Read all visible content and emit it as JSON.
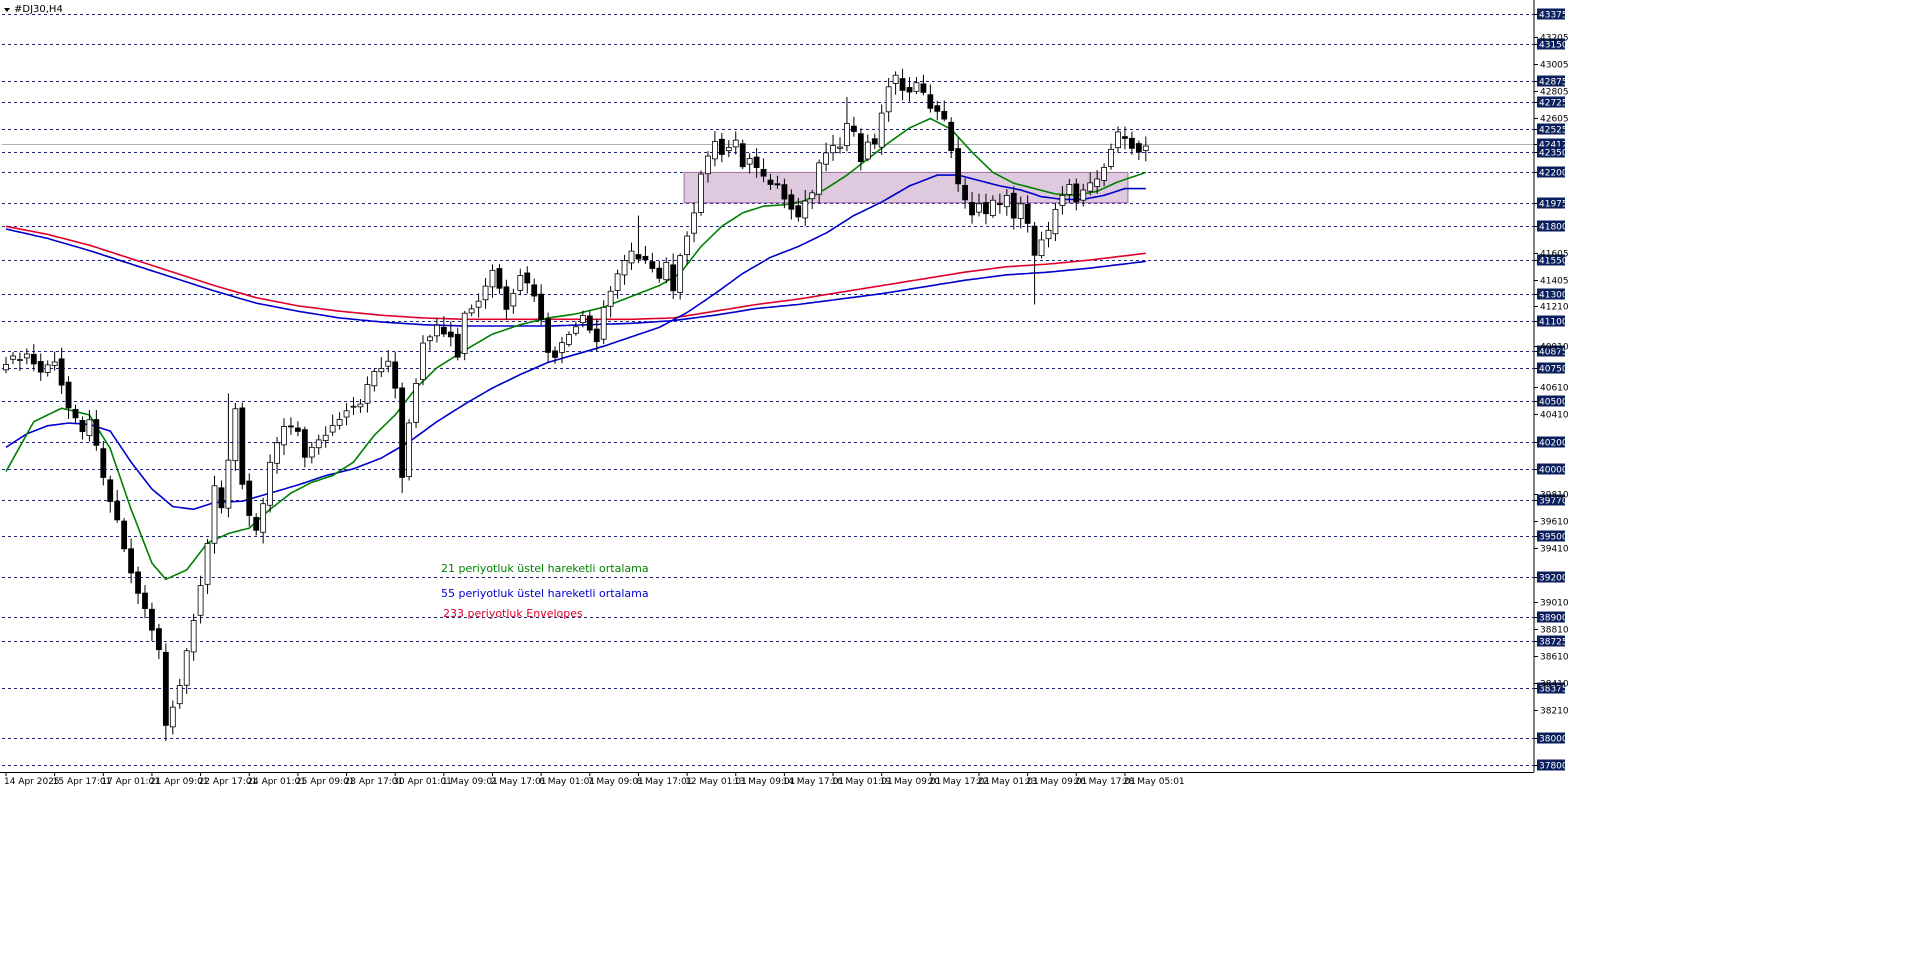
{
  "window": {
    "title": "#DJ30,H4"
  },
  "colors": {
    "background": "#ffffff",
    "grid": "#1a237e",
    "candle_up_fill": "#ffffff",
    "candle_down_fill": "#000000",
    "candle_outline": "#000000",
    "ema21": "#008000",
    "ema55": "#0000cd",
    "envelope_upper": "#e0002a",
    "envelope_lower": "#0000cd",
    "zone_fill": "#d8bfd8",
    "zone_stroke": "#a070a0",
    "label_box": "#0b1f5c",
    "label_text": "#ffffff",
    "price_line": "#b0b0b0"
  },
  "legend": [
    {
      "id": "ema21",
      "label": "21 periyotluk üstel hareketli ortalama",
      "color": "#008000"
    },
    {
      "id": "ema55",
      "label": "55 periyotluk üstel hareketli ortalama",
      "color": "#0000cd"
    },
    {
      "id": "env233",
      "label": "233 periyotluk Envelopes",
      "color": "#e0002a"
    }
  ],
  "chart_data": {
    "type": "candlestick",
    "symbol": "#DJ30",
    "timeframe": "H4",
    "ylim": [
      37750,
      43450
    ],
    "xlim": [
      0,
      207
    ],
    "grid": true,
    "current_price": 42412,
    "y_ticks_labeled": [
      43375,
      43150,
      42875,
      42725,
      42525,
      42412,
      42350,
      42200,
      41975,
      41800,
      41550,
      41300,
      41100,
      40875,
      40750,
      40500,
      40200,
      40000,
      39770,
      39500,
      39200,
      38900,
      38725,
      38375,
      38000,
      37800
    ],
    "y_ticks_minor": [
      43205,
      43005,
      42805,
      42605,
      41605,
      41405,
      41210,
      40910,
      40610,
      40410,
      39810,
      39610,
      39410,
      39010,
      38810,
      38610,
      38410,
      38210
    ],
    "x_ticks": [
      {
        "index": 0,
        "label": "14 Apr 2025"
      },
      {
        "index": 7,
        "label": "15 Apr 17:01"
      },
      {
        "index": 14,
        "label": "17 Apr 01:01"
      },
      {
        "index": 21,
        "label": "21 Apr 09:01"
      },
      {
        "index": 28,
        "label": "22 Apr 17:01"
      },
      {
        "index": 35,
        "label": "24 Apr 01:01"
      },
      {
        "index": 42,
        "label": "25 Apr 09:01"
      },
      {
        "index": 49,
        "label": "28 Apr 17:01"
      },
      {
        "index": 56,
        "label": "30 Apr 01:01"
      },
      {
        "index": 63,
        "label": "1 May 09:01"
      },
      {
        "index": 70,
        "label": "2 May 17:01"
      },
      {
        "index": 77,
        "label": "6 May 01:01"
      },
      {
        "index": 84,
        "label": "7 May 09:01"
      },
      {
        "index": 91,
        "label": "8 May 17:01"
      },
      {
        "index": 98,
        "label": "12 May 01:01"
      },
      {
        "index": 105,
        "label": "13 May 09:01"
      },
      {
        "index": 112,
        "label": "14 May 17:01"
      },
      {
        "index": 119,
        "label": "16 May 01:01"
      },
      {
        "index": 126,
        "label": "19 May 09:01"
      },
      {
        "index": 133,
        "label": "20 May 17:01"
      },
      {
        "index": 140,
        "label": "22 May 01:01"
      },
      {
        "index": 147,
        "label": "23 May 09:01"
      },
      {
        "index": 154,
        "label": "26 May 17:01"
      },
      {
        "index": 161,
        "label": "28 May 05:01"
      }
    ],
    "zone": {
      "x_start": 98,
      "x_end": 161,
      "y_low": 41975,
      "y_high": 42200
    },
    "close_anchors": [
      [
        0,
        40800
      ],
      [
        3,
        40850
      ],
      [
        5,
        40720
      ],
      [
        7,
        40810
      ],
      [
        9,
        40450
      ],
      [
        11,
        40260
      ],
      [
        12,
        40380
      ],
      [
        14,
        39920
      ],
      [
        16,
        39600
      ],
      [
        18,
        39220
      ],
      [
        20,
        38950
      ],
      [
        22,
        38650
      ],
      [
        23,
        38100
      ],
      [
        25,
        38400
      ],
      [
        27,
        38900
      ],
      [
        28,
        39150
      ],
      [
        29,
        39450
      ],
      [
        30,
        39850
      ],
      [
        31,
        39700
      ],
      [
        33,
        40450
      ],
      [
        34,
        39900
      ],
      [
        35,
        39650
      ],
      [
        36,
        39520
      ],
      [
        37,
        39720
      ],
      [
        38,
        40050
      ],
      [
        40,
        40310
      ],
      [
        42,
        40280
      ],
      [
        43,
        40100
      ],
      [
        45,
        40200
      ],
      [
        47,
        40320
      ],
      [
        49,
        40450
      ],
      [
        51,
        40500
      ],
      [
        53,
        40720
      ],
      [
        55,
        40780
      ],
      [
        56,
        40600
      ],
      [
        57,
        39950
      ],
      [
        58,
        40350
      ],
      [
        60,
        40950
      ],
      [
        62,
        41050
      ],
      [
        64,
        41000
      ],
      [
        65,
        40850
      ],
      [
        66,
        41150
      ],
      [
        68,
        41250
      ],
      [
        70,
        41480
      ],
      [
        72,
        41200
      ],
      [
        74,
        41450
      ],
      [
        76,
        41300
      ],
      [
        77,
        41100
      ],
      [
        78,
        40880
      ],
      [
        79,
        40850
      ],
      [
        81,
        41000
      ],
      [
        83,
        41150
      ],
      [
        85,
        40950
      ],
      [
        86,
        41200
      ],
      [
        88,
        41450
      ],
      [
        90,
        41600
      ],
      [
        92,
        41550
      ],
      [
        94,
        41400
      ],
      [
        95,
        41520
      ],
      [
        96,
        41300
      ],
      [
        97,
        41600
      ],
      [
        98,
        41750
      ],
      [
        99,
        41900
      ],
      [
        100,
        42200
      ],
      [
        101,
        42300
      ],
      [
        102,
        42450
      ],
      [
        103,
        42350
      ],
      [
        105,
        42420
      ],
      [
        106,
        42250
      ],
      [
        107,
        42300
      ],
      [
        109,
        42150
      ],
      [
        111,
        42100
      ],
      [
        113,
        41950
      ],
      [
        114,
        41870
      ],
      [
        115,
        41990
      ],
      [
        116,
        42050
      ],
      [
        117,
        42250
      ],
      [
        118,
        42350
      ],
      [
        120,
        42400
      ],
      [
        121,
        42550
      ],
      [
        122,
        42480
      ],
      [
        123,
        42300
      ],
      [
        124,
        42450
      ],
      [
        125,
        42400
      ],
      [
        126,
        42650
      ],
      [
        127,
        42850
      ],
      [
        128,
        42900
      ],
      [
        129,
        42820
      ],
      [
        130,
        42800
      ],
      [
        131,
        42850
      ],
      [
        132,
        42780
      ],
      [
        133,
        42700
      ],
      [
        134,
        42650
      ],
      [
        135,
        42580
      ],
      [
        136,
        42380
      ],
      [
        137,
        42100
      ],
      [
        138,
        41980
      ],
      [
        139,
        41900
      ],
      [
        140,
        41970
      ],
      [
        141,
        41880
      ],
      [
        142,
        41980
      ],
      [
        143,
        41950
      ],
      [
        144,
        42050
      ],
      [
        145,
        41850
      ],
      [
        146,
        41950
      ],
      [
        147,
        41800
      ],
      [
        148,
        41580
      ],
      [
        149,
        41700
      ],
      [
        150,
        41750
      ],
      [
        151,
        41950
      ],
      [
        152,
        42050
      ],
      [
        153,
        42100
      ],
      [
        154,
        41980
      ],
      [
        155,
        42050
      ],
      [
        156,
        42100
      ],
      [
        157,
        42150
      ],
      [
        158,
        42250
      ],
      [
        159,
        42380
      ],
      [
        160,
        42480
      ],
      [
        161,
        42450
      ],
      [
        162,
        42400
      ],
      [
        163,
        42350
      ],
      [
        164,
        42412
      ]
    ],
    "wick_extremes": [
      {
        "index": 23,
        "low": 37980
      },
      {
        "index": 29,
        "high": 39480
      },
      {
        "index": 32,
        "high": 40560
      },
      {
        "index": 57,
        "low": 39820
      },
      {
        "index": 91,
        "high": 41880
      },
      {
        "index": 121,
        "high": 42760
      },
      {
        "index": 128,
        "high": 42950
      },
      {
        "index": 148,
        "low": 41220
      },
      {
        "index": 147,
        "high": 42030
      }
    ],
    "series": [
      {
        "name": "21 periyotluk üstel hareketli ortalama",
        "color": "#008000",
        "points": [
          [
            0,
            39980
          ],
          [
            4,
            40350
          ],
          [
            8,
            40450
          ],
          [
            12,
            40400
          ],
          [
            15,
            40150
          ],
          [
            18,
            39700
          ],
          [
            21,
            39300
          ],
          [
            23,
            39180
          ],
          [
            26,
            39250
          ],
          [
            29,
            39450
          ],
          [
            32,
            39520
          ],
          [
            35,
            39560
          ],
          [
            38,
            39700
          ],
          [
            41,
            39820
          ],
          [
            44,
            39900
          ],
          [
            47,
            39950
          ],
          [
            50,
            40050
          ],
          [
            53,
            40250
          ],
          [
            56,
            40400
          ],
          [
            59,
            40600
          ],
          [
            62,
            40750
          ],
          [
            66,
            40880
          ],
          [
            70,
            41000
          ],
          [
            74,
            41070
          ],
          [
            78,
            41120
          ],
          [
            82,
            41150
          ],
          [
            86,
            41200
          ],
          [
            90,
            41280
          ],
          [
            94,
            41360
          ],
          [
            97,
            41450
          ],
          [
            100,
            41650
          ],
          [
            103,
            41800
          ],
          [
            106,
            41900
          ],
          [
            109,
            41950
          ],
          [
            112,
            41960
          ],
          [
            115,
            41990
          ],
          [
            118,
            42080
          ],
          [
            121,
            42180
          ],
          [
            124,
            42300
          ],
          [
            127,
            42420
          ],
          [
            130,
            42530
          ],
          [
            133,
            42600
          ],
          [
            136,
            42520
          ],
          [
            139,
            42350
          ],
          [
            142,
            42200
          ],
          [
            145,
            42120
          ],
          [
            148,
            42080
          ],
          [
            151,
            42040
          ],
          [
            154,
            42030
          ],
          [
            157,
            42060
          ],
          [
            160,
            42130
          ],
          [
            164,
            42200
          ]
        ]
      },
      {
        "name": "55 periyotluk üstel hareketli ortalama",
        "color": "#0000cd",
        "points": [
          [
            0,
            40160
          ],
          [
            3,
            40260
          ],
          [
            6,
            40320
          ],
          [
            9,
            40340
          ],
          [
            12,
            40330
          ],
          [
            15,
            40280
          ],
          [
            18,
            40050
          ],
          [
            21,
            39850
          ],
          [
            24,
            39720
          ],
          [
            27,
            39700
          ],
          [
            30,
            39750
          ],
          [
            34,
            39760
          ],
          [
            38,
            39820
          ],
          [
            42,
            39880
          ],
          [
            46,
            39950
          ],
          [
            50,
            40000
          ],
          [
            54,
            40080
          ],
          [
            58,
            40200
          ],
          [
            62,
            40350
          ],
          [
            66,
            40480
          ],
          [
            70,
            40600
          ],
          [
            74,
            40700
          ],
          [
            78,
            40790
          ],
          [
            82,
            40850
          ],
          [
            86,
            40910
          ],
          [
            90,
            40980
          ],
          [
            94,
            41050
          ],
          [
            98,
            41160
          ],
          [
            102,
            41300
          ],
          [
            106,
            41450
          ],
          [
            110,
            41570
          ],
          [
            114,
            41650
          ],
          [
            118,
            41750
          ],
          [
            122,
            41880
          ],
          [
            126,
            41980
          ],
          [
            130,
            42100
          ],
          [
            134,
            42180
          ],
          [
            137,
            42180
          ],
          [
            140,
            42140
          ],
          [
            143,
            42100
          ],
          [
            146,
            42070
          ],
          [
            149,
            42020
          ],
          [
            152,
            42000
          ],
          [
            155,
            42000
          ],
          [
            158,
            42030
          ],
          [
            161,
            42080
          ],
          [
            164,
            42080
          ]
        ]
      },
      {
        "name": "233 periyotluk Envelopes (üst)",
        "color": "#e0002a",
        "points": [
          [
            0,
            41800
          ],
          [
            6,
            41740
          ],
          [
            12,
            41660
          ],
          [
            18,
            41560
          ],
          [
            24,
            41460
          ],
          [
            30,
            41360
          ],
          [
            36,
            41270
          ],
          [
            42,
            41210
          ],
          [
            48,
            41170
          ],
          [
            54,
            41140
          ],
          [
            60,
            41120
          ],
          [
            66,
            41110
          ],
          [
            72,
            41110
          ],
          [
            78,
            41110
          ],
          [
            84,
            41110
          ],
          [
            90,
            41110
          ],
          [
            96,
            41120
          ],
          [
            102,
            41170
          ],
          [
            108,
            41220
          ],
          [
            114,
            41260
          ],
          [
            120,
            41310
          ],
          [
            126,
            41360
          ],
          [
            132,
            41410
          ],
          [
            138,
            41460
          ],
          [
            144,
            41500
          ],
          [
            150,
            41520
          ],
          [
            156,
            41550
          ],
          [
            164,
            41600
          ]
        ]
      },
      {
        "name": "233 periyotluk Envelopes (alt)",
        "color": "#0000cd",
        "points": [
          [
            0,
            41780
          ],
          [
            6,
            41710
          ],
          [
            12,
            41620
          ],
          [
            18,
            41520
          ],
          [
            24,
            41420
          ],
          [
            30,
            41320
          ],
          [
            36,
            41230
          ],
          [
            42,
            41170
          ],
          [
            48,
            41120
          ],
          [
            54,
            41090
          ],
          [
            60,
            41070
          ],
          [
            66,
            41060
          ],
          [
            72,
            41060
          ],
          [
            78,
            41060
          ],
          [
            84,
            41070
          ],
          [
            90,
            41080
          ],
          [
            96,
            41100
          ],
          [
            102,
            41140
          ],
          [
            108,
            41190
          ],
          [
            114,
            41220
          ],
          [
            120,
            41260
          ],
          [
            126,
            41300
          ],
          [
            132,
            41350
          ],
          [
            138,
            41400
          ],
          [
            144,
            41440
          ],
          [
            150,
            41460
          ],
          [
            156,
            41490
          ],
          [
            164,
            41540
          ]
        ]
      }
    ]
  }
}
